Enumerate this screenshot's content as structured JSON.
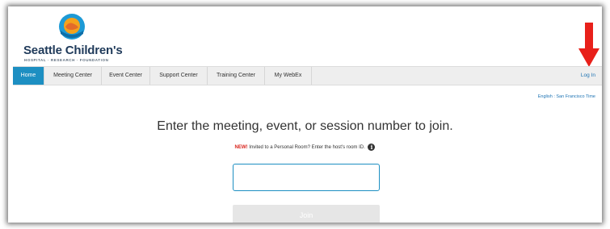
{
  "brand": {
    "name": "Seattle Children's",
    "tagline": "HOSPITAL · RESEARCH · FOUNDATION"
  },
  "nav": {
    "tabs": [
      {
        "label": "Home",
        "active": true
      },
      {
        "label": "Meeting Center",
        "active": false
      },
      {
        "label": "Event Center",
        "active": false
      },
      {
        "label": "Support Center",
        "active": false
      },
      {
        "label": "Training Center",
        "active": false
      },
      {
        "label": "My WebEx",
        "active": false
      }
    ],
    "login_label": "Log In"
  },
  "locale_text": "English : San Francisco Time",
  "main": {
    "heading": "Enter the meeting, event, or session number to join.",
    "new_tag": "NEW!",
    "subline": " Invited to a Personal Room? Enter the host's room ID.",
    "input_value": "",
    "join_label": "Join"
  },
  "colors": {
    "accent": "#1d8fc2",
    "link": "#1d73b3",
    "new_tag": "#d9231c",
    "arrow": "#e8201a"
  },
  "icons": [
    "seattle-childrens-logo-icon",
    "info-icon",
    "red-arrow-icon"
  ]
}
